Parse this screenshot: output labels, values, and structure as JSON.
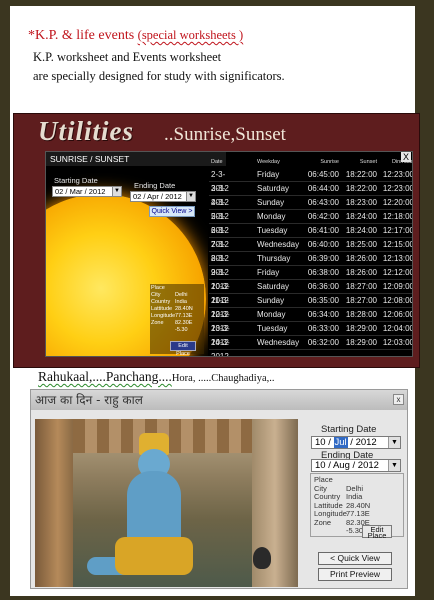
{
  "intro": {
    "title_main": "*K.P. & life events",
    "title_paren": "(special worksheets )",
    "line1": "K.P. worksheet and Events worksheet",
    "line2": "are specially designed for study with significators."
  },
  "utilities": {
    "heading": "Utilities",
    "subheading": "..Sunrise,Sunset",
    "window_title": "SUNRISE / SUNSET",
    "close": "X",
    "starting_label": "Starting Date",
    "starting_value": "02 / Mar / 2012",
    "ending_label": "Ending Date",
    "ending_value": "02 / Apr / 2012",
    "quick_view": "Quick View >",
    "place": {
      "heading": "Place",
      "fields": [
        {
          "key": "City",
          "value": "Delhi"
        },
        {
          "key": "Country",
          "value": "India"
        },
        {
          "key": "Lattitude",
          "value": "28.40N"
        },
        {
          "key": "Longitude",
          "value": "77.13E"
        },
        {
          "key": "Zone",
          "value": "82.30E"
        },
        {
          "key": "",
          "value": "-5.30"
        }
      ],
      "edit": "Edit Place"
    },
    "columns": [
      "Date",
      "Weekday",
      "Sunrise",
      "Sunset",
      "Dinmaan"
    ],
    "rows": [
      [
        "2-3-2012",
        "Friday",
        "06:45:00",
        "18:22:00",
        "12:23:00"
      ],
      [
        "3-3-2012",
        "Saturday",
        "06:44:00",
        "18:22:00",
        "12:23:00"
      ],
      [
        "4-3-2012",
        "Sunday",
        "06:43:00",
        "18:23:00",
        "12:20:00"
      ],
      [
        "5-3-2012",
        "Monday",
        "06:42:00",
        "18:24:00",
        "12:18:00"
      ],
      [
        "6-3-2012",
        "Tuesday",
        "06:41:00",
        "18:24:00",
        "12:17:00"
      ],
      [
        "7-3-2012",
        "Wednesday",
        "06:40:00",
        "18:25:00",
        "12:15:00"
      ],
      [
        "8-3-2012",
        "Thursday",
        "06:39:00",
        "18:26:00",
        "12:13:00"
      ],
      [
        "9-3-2012",
        "Friday",
        "06:38:00",
        "18:26:00",
        "12:12:00"
      ],
      [
        "10-3-2012",
        "Saturday",
        "06:36:00",
        "18:27:00",
        "12:09:00"
      ],
      [
        "11-3-2012",
        "Sunday",
        "06:35:00",
        "18:27:00",
        "12:08:00"
      ],
      [
        "12-3-2012",
        "Monday",
        "06:34:00",
        "18:28:00",
        "12:06:00"
      ],
      [
        "13-3-2012",
        "Tuesday",
        "06:33:00",
        "18:29:00",
        "12:04:00"
      ],
      [
        "14-3-2012",
        "Wednesday",
        "06:32:00",
        "18:29:00",
        "12:03:00"
      ]
    ]
  },
  "rahu_line": {
    "part1": "Rahukaal,....Panchang....",
    "part2": "Hora,",
    "part3": " .....Chaughadiya,.."
  },
  "panchang": {
    "window_title": "आज का दिन - राहु काल",
    "close": "x",
    "starting_label": "Starting Date",
    "start_day": "10 /",
    "start_month": "Jul",
    "start_year": "/ 2012",
    "ending_label": "Ending Date",
    "ending_value": "10 / Aug / 2012",
    "place": {
      "heading": "Place",
      "fields": [
        {
          "key": "City",
          "value": "Delhi"
        },
        {
          "key": "Country",
          "value": "India"
        },
        {
          "key": "Lattitude",
          "value": "28.40N"
        },
        {
          "key": "Longitude",
          "value": "77.13E"
        },
        {
          "key": "Zone",
          "value": "82.30E"
        },
        {
          "key": "",
          "value": "-5.30"
        }
      ],
      "edit": "Edit Place"
    },
    "quick_view": "< Quick View",
    "print_preview": "Print Preview"
  }
}
